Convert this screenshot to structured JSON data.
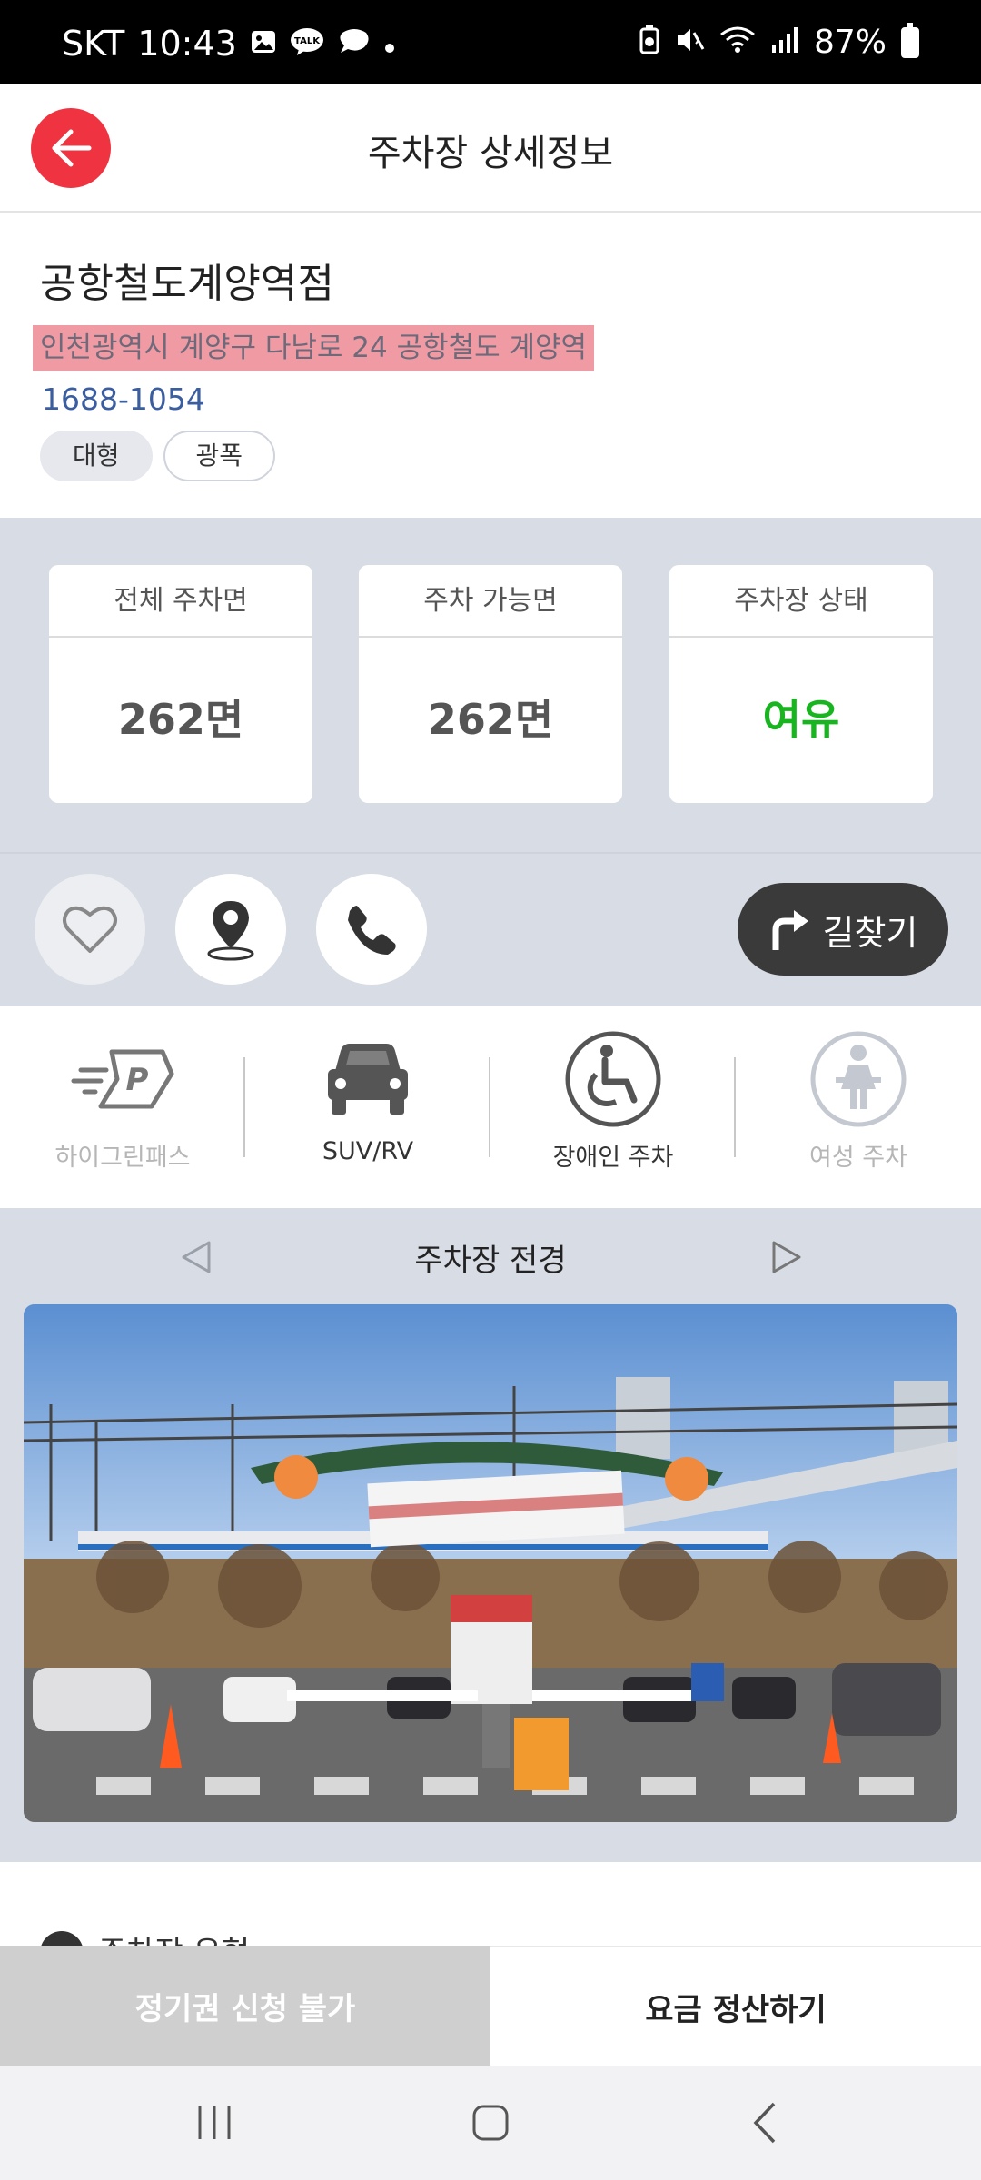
{
  "status_bar": {
    "carrier": "SKT",
    "time": "10:43",
    "battery": "87%",
    "left_icons": [
      "gallery-icon",
      "kakaotalk-icon",
      "chat-icon",
      "dot-icon"
    ],
    "right_icons": [
      "battery-saver-icon",
      "mute-icon",
      "wifi-icon",
      "signal-icon",
      "battery-icon"
    ]
  },
  "header": {
    "title": "주차장 상세정보",
    "back_icon": "back-arrow-icon"
  },
  "info": {
    "name": "공항철도계양역점",
    "address": "인천광역시 계양구 다남로 24 공항철도 계양역",
    "phone": "1688-1054",
    "tags": [
      "대형",
      "광폭"
    ]
  },
  "stats": [
    {
      "label": "전체 주차면",
      "value": "262면"
    },
    {
      "label": "주차 가능면",
      "value": "262면"
    },
    {
      "label": "주차장 상태",
      "value": "여유"
    }
  ],
  "actions": {
    "favorite_icon": "heart-icon",
    "location_icon": "map-pin-icon",
    "phone_icon": "phone-icon",
    "route_label": "길찾기",
    "route_icon": "turn-right-arrow-icon"
  },
  "features": [
    {
      "label": "하이그린패스",
      "icon": "hi-green-pass-icon",
      "enabled": false
    },
    {
      "label": "SUV/RV",
      "icon": "car-icon",
      "enabled": true
    },
    {
      "label": "장애인 주차",
      "icon": "wheelchair-icon",
      "enabled": true
    },
    {
      "label": "여성 주차",
      "icon": "woman-icon",
      "enabled": false
    }
  ],
  "photo_section": {
    "title": "주차장 전경",
    "prev_icon": "triangle-left-icon",
    "next_icon": "triangle-right-icon"
  },
  "partial_section": {
    "title": "주차장 유형"
  },
  "bottom_buttons": {
    "season_pass": "정기권 신청 불가",
    "pay": "요금 정산하기"
  },
  "nav": {
    "recent_icon": "recent-apps-icon",
    "home_icon": "home-icon",
    "back_icon": "nav-back-icon"
  },
  "colors": {
    "accent_red": "#ef3340",
    "status_green": "#19b520",
    "section_bg": "#d8dce4",
    "phone_link": "#3b5ea0",
    "address_highlight": "#f09aa4"
  }
}
